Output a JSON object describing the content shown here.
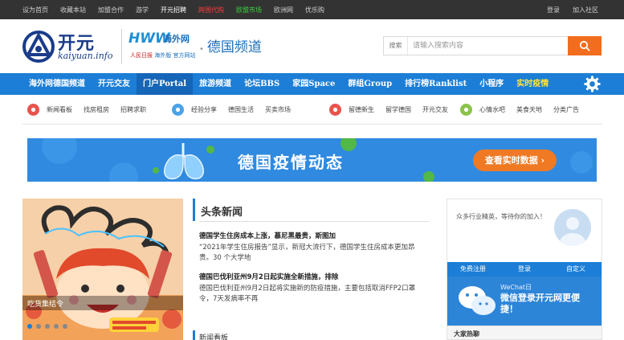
{
  "topbar": {
    "links": [
      {
        "label": "设为首页",
        "style": "normal"
      },
      {
        "label": "收藏本站",
        "style": "normal"
      },
      {
        "label": "加盟合作",
        "style": "normal"
      },
      {
        "label": "游学",
        "style": "normal"
      },
      {
        "label": "开元招聘",
        "style": "white"
      },
      {
        "label": "跨国代购",
        "style": "red"
      },
      {
        "label": "欧盟市场",
        "style": "green"
      },
      {
        "label": "欧洲网",
        "style": "normal"
      },
      {
        "label": "优乐购",
        "style": "normal"
      }
    ],
    "login": "登录",
    "join": "加入社区"
  },
  "header": {
    "logo_cn": "开元",
    "logo_en": "kaiyuan.info",
    "partner_big": "HWW",
    "partner_cn": "海外网",
    "partner_sub_red": "人民日报",
    "partner_sub_blue": "海外版 官方网站",
    "channel": "德国频道",
    "channel_dot": "•",
    "search": {
      "select_label": "搜索",
      "placeholder": "请输入搜索内容"
    }
  },
  "nav": {
    "items": [
      {
        "label": "海外网德国频道",
        "state": "normal"
      },
      {
        "label": "开元交友",
        "state": "normal"
      },
      {
        "label": "门户Portal",
        "state": "active"
      },
      {
        "label": "旅游频道",
        "state": "normal"
      },
      {
        "label": "论坛BBS",
        "state": "normal"
      },
      {
        "label": "家园Space",
        "state": "normal"
      },
      {
        "label": "群组Group",
        "state": "normal"
      },
      {
        "label": "排行榜Ranklist",
        "state": "normal"
      },
      {
        "label": "小程序",
        "state": "normal"
      },
      {
        "label": "实时疫情",
        "state": "hot"
      }
    ]
  },
  "subnav": {
    "groups": [
      {
        "icon": "news-icon",
        "color": "#e8534c",
        "items": [
          "新闻看板",
          "找房租房",
          "招聘求职"
        ]
      },
      {
        "icon": "share-icon",
        "color": "#4aa3e8",
        "items": [
          "经验分享",
          "德国生活",
          "买卖市场"
        ]
      },
      {
        "icon": "student-icon",
        "color": "#e8534c",
        "items": [
          "留德新生",
          "留学德国",
          "开元交友"
        ]
      },
      {
        "icon": "heart-icon",
        "color": "#8bc34a",
        "items": [
          "心情水吧",
          "美食天地",
          "分类广告"
        ]
      }
    ]
  },
  "banner": {
    "title": "德国疫情动态",
    "cta": "查看实时数据 ›"
  },
  "slideshow": {
    "caption": "吃货集结令",
    "dots": [
      true,
      false,
      false,
      false,
      false
    ]
  },
  "headline": {
    "section_title": "头条新闻",
    "items": [
      {
        "title": "德国学生住房成本上涨，慕尼黑最贵，斯图加",
        "desc": "“2021年学生住房报告”显示，新冠大流行下，德国学生住房成本更加昂贵。30 个大学地"
      },
      {
        "title": "德国巴伐利亚州9月2日起实施全新措施，排除",
        "desc": "德国巴伐利亚州9月2日起将实施新的防疫措施，主要包括取消FFP2口罩令，7天发病率不再"
      }
    ],
    "next_section": "新闻看板"
  },
  "login_panel": {
    "prompt": "众多行业精英，等待你的加入！",
    "tabs": [
      "免费注册",
      "登录",
      "自定义"
    ],
    "wechat_label": "WeChat日",
    "wechat_text": "微信登录开元网更便捷！",
    "bottom_title": "大家热聊"
  },
  "colors": {
    "topbar": "#333333",
    "nav": "#1c7ed6",
    "search_button": "#f26d1d",
    "banner": "#2f8ae0",
    "cta": "#f07a24"
  }
}
